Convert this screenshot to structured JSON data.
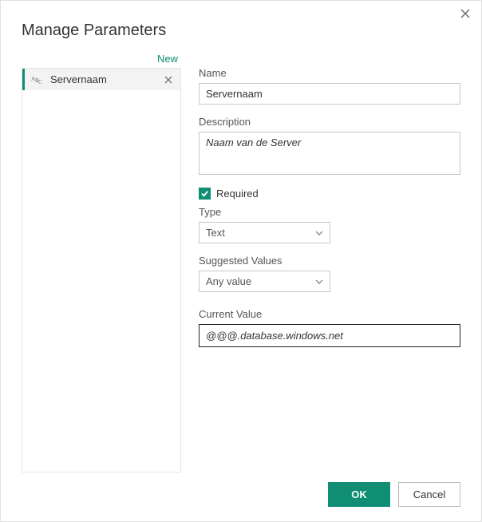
{
  "dialog": {
    "title": "Manage Parameters",
    "new_link": "New",
    "close_tooltip": "Close"
  },
  "paramList": {
    "items": [
      {
        "label": "Servernaam"
      }
    ]
  },
  "fields": {
    "name_label": "Name",
    "name_value": "Servernaam",
    "description_label": "Description",
    "description_value": "Naam van de Server",
    "required_label": "Required",
    "required_checked": true,
    "type_label": "Type",
    "type_value": "Text",
    "suggested_label": "Suggested Values",
    "suggested_value": "Any value",
    "current_label": "Current Value",
    "current_value": "@@@.database.windows.net"
  },
  "buttons": {
    "ok": "OK",
    "cancel": "Cancel"
  }
}
